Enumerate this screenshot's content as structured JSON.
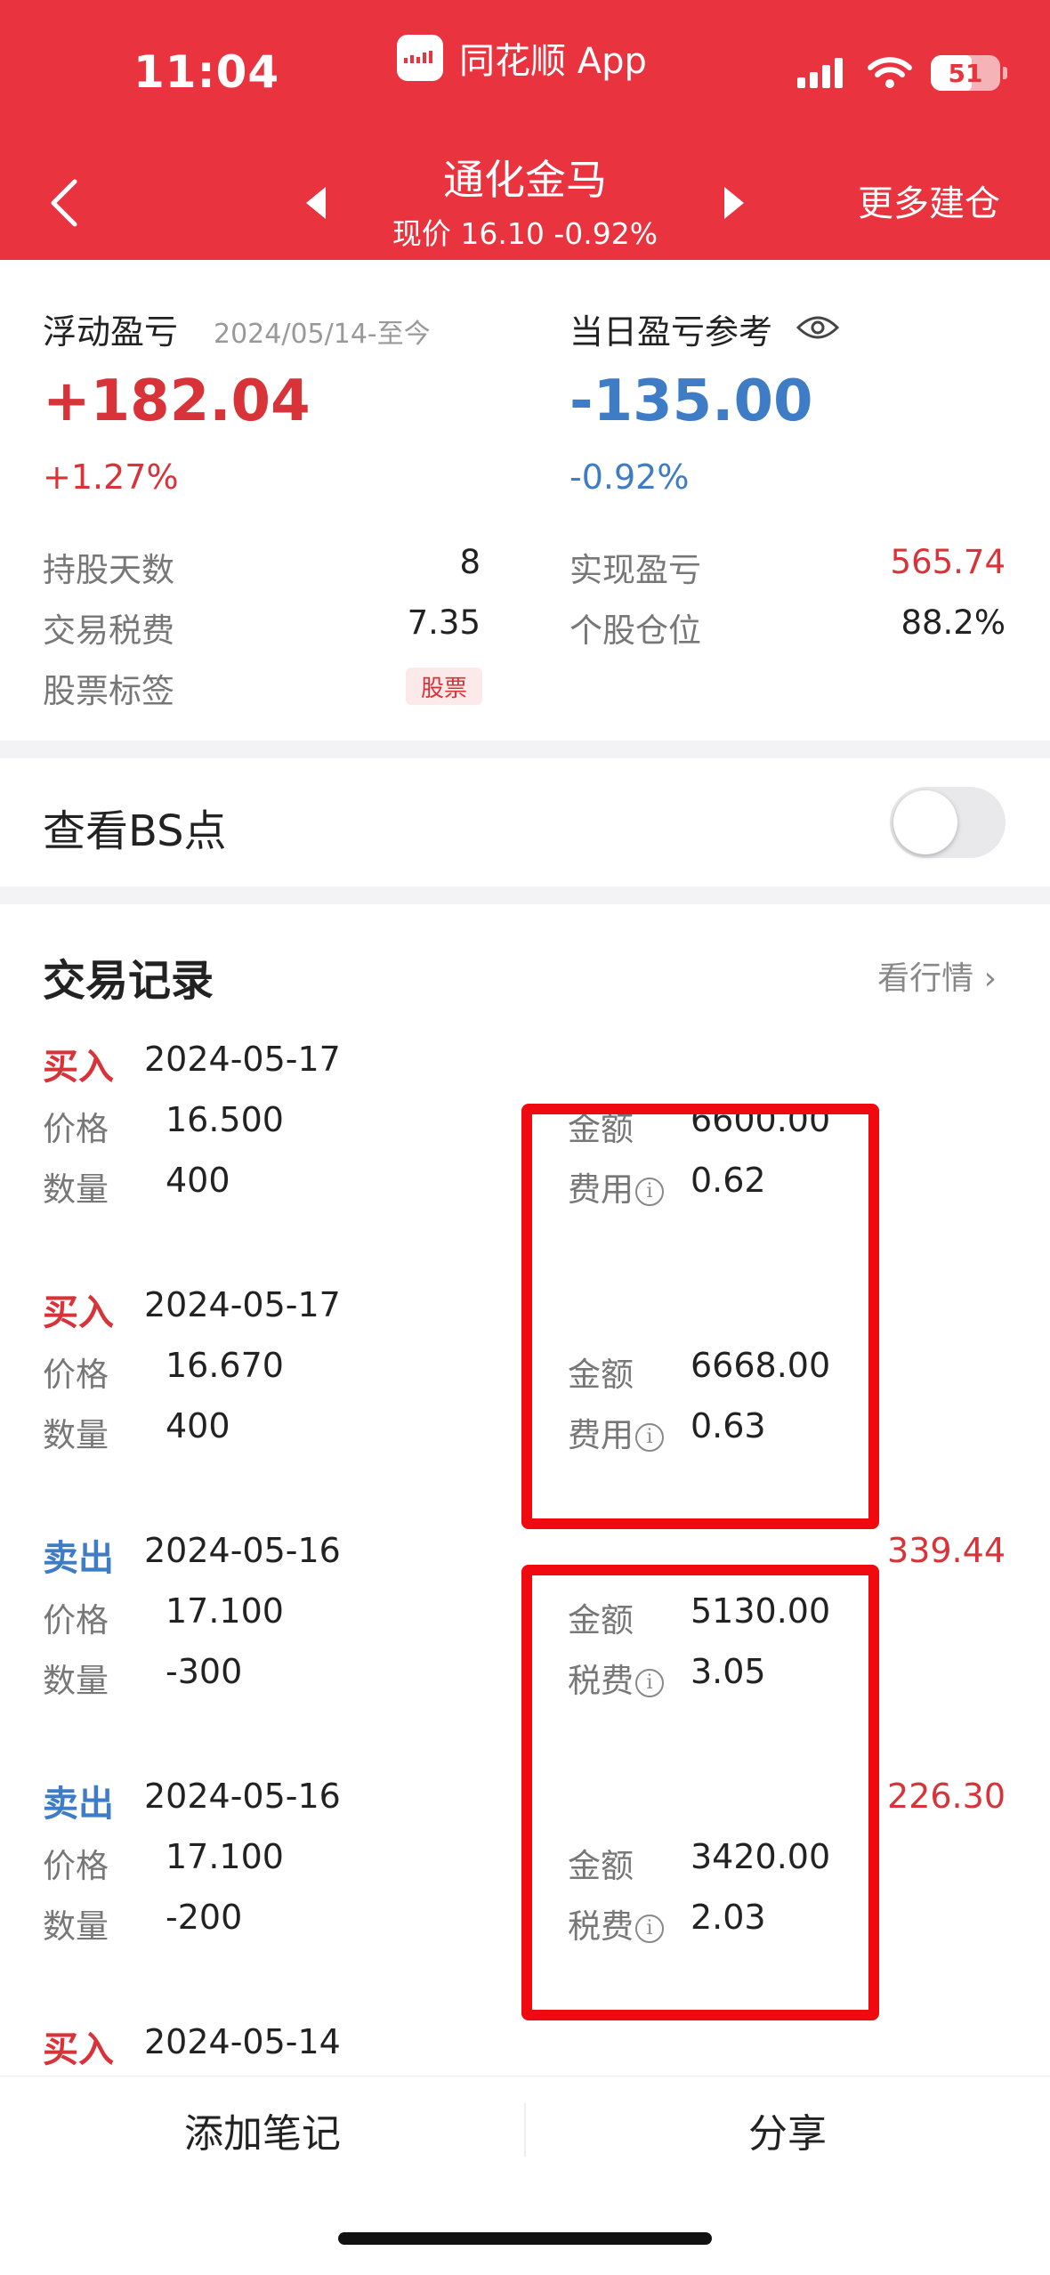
{
  "status_bar": {
    "time": "11:04",
    "app_name": "同花顺 App",
    "battery": "51"
  },
  "header": {
    "stock_name": "通化金马",
    "price_line": "现价 16.10 -0.92%",
    "more_label": "更多建仓"
  },
  "summary": {
    "float_label": "浮动盈亏",
    "date_range": "2024/05/14-至今",
    "float_value": "+182.04",
    "float_pct": "+1.27%",
    "day_label": "当日盈亏参考",
    "day_value": "-135.00",
    "day_pct": "-0.92%",
    "hold_days_label": "持股天数",
    "hold_days_value": "8",
    "fee_label": "交易税费",
    "fee_value": "7.35",
    "tag_label": "股票标签",
    "tag_value": "股票",
    "realized_label": "实现盈亏",
    "realized_value": "565.74",
    "position_label": "个股仓位",
    "position_value": "88.2%"
  },
  "bs_point": {
    "label": "查看BS点",
    "enabled": false
  },
  "records": {
    "title": "交易记录",
    "link": "看行情 ›",
    "price_label": "价格",
    "qty_label": "数量",
    "amount_label": "金额",
    "items": [
      {
        "type": "买入",
        "date": "2024-05-17",
        "price": "16.500",
        "qty": "400",
        "amount": "6600.00",
        "fee_label": "费用",
        "fee": "0.62",
        "profit": ""
      },
      {
        "type": "买入",
        "date": "2024-05-17",
        "price": "16.670",
        "qty": "400",
        "amount": "6668.00",
        "fee_label": "费用",
        "fee": "0.63",
        "profit": ""
      },
      {
        "type": "卖出",
        "date": "2024-05-16",
        "price": "17.100",
        "qty": "-300",
        "amount": "5130.00",
        "fee_label": "税费",
        "fee": "3.05",
        "profit": "339.44"
      },
      {
        "type": "卖出",
        "date": "2024-05-16",
        "price": "17.100",
        "qty": "-200",
        "amount": "3420.00",
        "fee_label": "税费",
        "fee": "2.03",
        "profit": "226.30"
      },
      {
        "type": "买入",
        "date": "2024-05-14"
      }
    ]
  },
  "bottom_bar": {
    "add_note": "添加笔记",
    "share": "分享"
  },
  "colors": {
    "header_red": "#E9333F",
    "gain_red": "#D9333A",
    "loss_blue": "#3E7CC6",
    "highlight_box": "#F00A0F"
  }
}
